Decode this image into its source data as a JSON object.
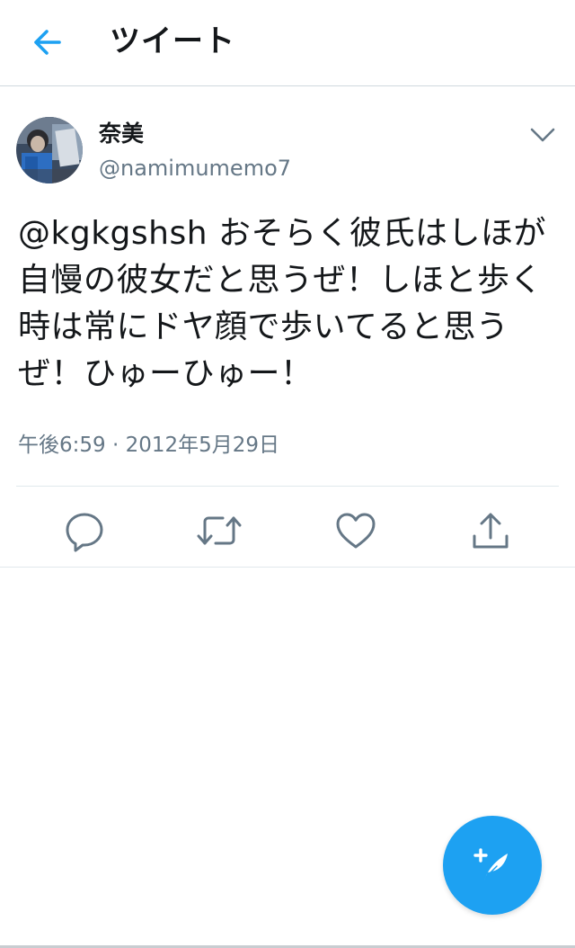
{
  "header": {
    "title": "ツイート",
    "back_icon": "arrow-left-icon"
  },
  "tweet": {
    "author": {
      "display_name": "奈美",
      "handle": "@namimumemo7",
      "avatar": "avatar-photo"
    },
    "mention": "@kgkgshsh",
    "body": " おそらく彼氏はしほが自慢の彼女だと思うぜ！しほと歩く時は常にドヤ顔で歩いてると思うぜ！ひゅーひゅー！",
    "timestamp": "午後6:59 · 2012年5月29日"
  },
  "actions": {
    "reply": "reply-icon",
    "retweet": "retweet-icon",
    "like": "heart-icon",
    "share": "share-icon"
  },
  "fab": {
    "icon": "compose-tweet-icon"
  },
  "colors": {
    "accent": "#1da1f2",
    "secondary_text": "#657786",
    "icon_gray": "#657786",
    "divider": "#e1e8ed"
  }
}
